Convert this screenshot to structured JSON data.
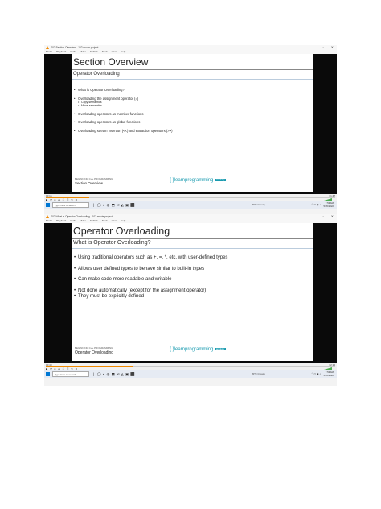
{
  "shots": [
    {
      "window_title": "S02 Section Overview - 102 movie project",
      "menu": [
        "Media",
        "Playback",
        "Audio",
        "Video",
        "Subtitle",
        "Tools",
        "View",
        "Help"
      ],
      "slide": {
        "title": "Section Overview",
        "subtitle": "Operator Overloading",
        "bullets": [
          {
            "text": "What is Operator Overloading?",
            "level": 1
          },
          {
            "text": "Overloading the assignment operator (=)",
            "level": 1
          },
          {
            "text": "Copy semantics",
            "level": 2
          },
          {
            "text": "Move semantics",
            "level": 2
          },
          {
            "text": "Overloading operators as member functions",
            "level": 1
          },
          {
            "text": "Overloading operators as global functions",
            "level": 1
          },
          {
            "text": "Overloading  stream insertion (<<) and extraction operators (>>)",
            "level": 1
          }
        ],
        "footer_course": "BEGINNING C++ PROGRAMMING",
        "footer_section": "Section Overview",
        "logo_text": "{ }learnprogramming",
        "logo_badge": "academy"
      },
      "player": {
        "time_left": "00:16",
        "time_right": "01:47",
        "progress": 0.15
      },
      "taskbar": {
        "search_placeholder": "Type here to search",
        "weather": "20°C  Cloudy",
        "time": "7:53 AM",
        "date": "5/26/2022"
      }
    },
    {
      "window_title": "S02 What is Operator Overloading - 102 movie project",
      "menu": [
        "Media",
        "Playback",
        "Audio",
        "Video",
        "Subtitle",
        "Tools",
        "View",
        "Help"
      ],
      "slide": {
        "title": "Operator Overloading",
        "subtitle": "What is Operator Overloading?",
        "bullets": [
          {
            "text": "Using traditional operators  such as +, =, *, etc. with user-defined types",
            "level": 1
          },
          {
            "text": "Allows user defined types to behave similar to built-in types",
            "level": 1
          },
          {
            "text": "Can make code more readable and writable",
            "level": 1
          },
          {
            "text": "Not done automatically (except for the assignment operator)",
            "level": 1
          },
          {
            "text": "They must be explicitly defined",
            "level": 3
          }
        ],
        "footer_course": "BEGINNING C++ PROGRAMMING",
        "footer_section": "Operator Overloading",
        "logo_text": "{ }learnprogramming",
        "logo_badge": "academy"
      },
      "player": {
        "time_left": "00:40",
        "time_right": "02:15",
        "progress": 0.3
      },
      "taskbar": {
        "search_placeholder": "Type here to search",
        "weather": "20°C  Cloudy",
        "time": "7:53 AM",
        "date": "5/26/2022"
      }
    }
  ],
  "icons": {
    "player_controls": "play-pause-stop-prev-next-fullscreen-playlist-loop-shuffle",
    "taskbar_apps": "task-view, edge, chrome, explorer, store, mail, vlc, photos"
  }
}
